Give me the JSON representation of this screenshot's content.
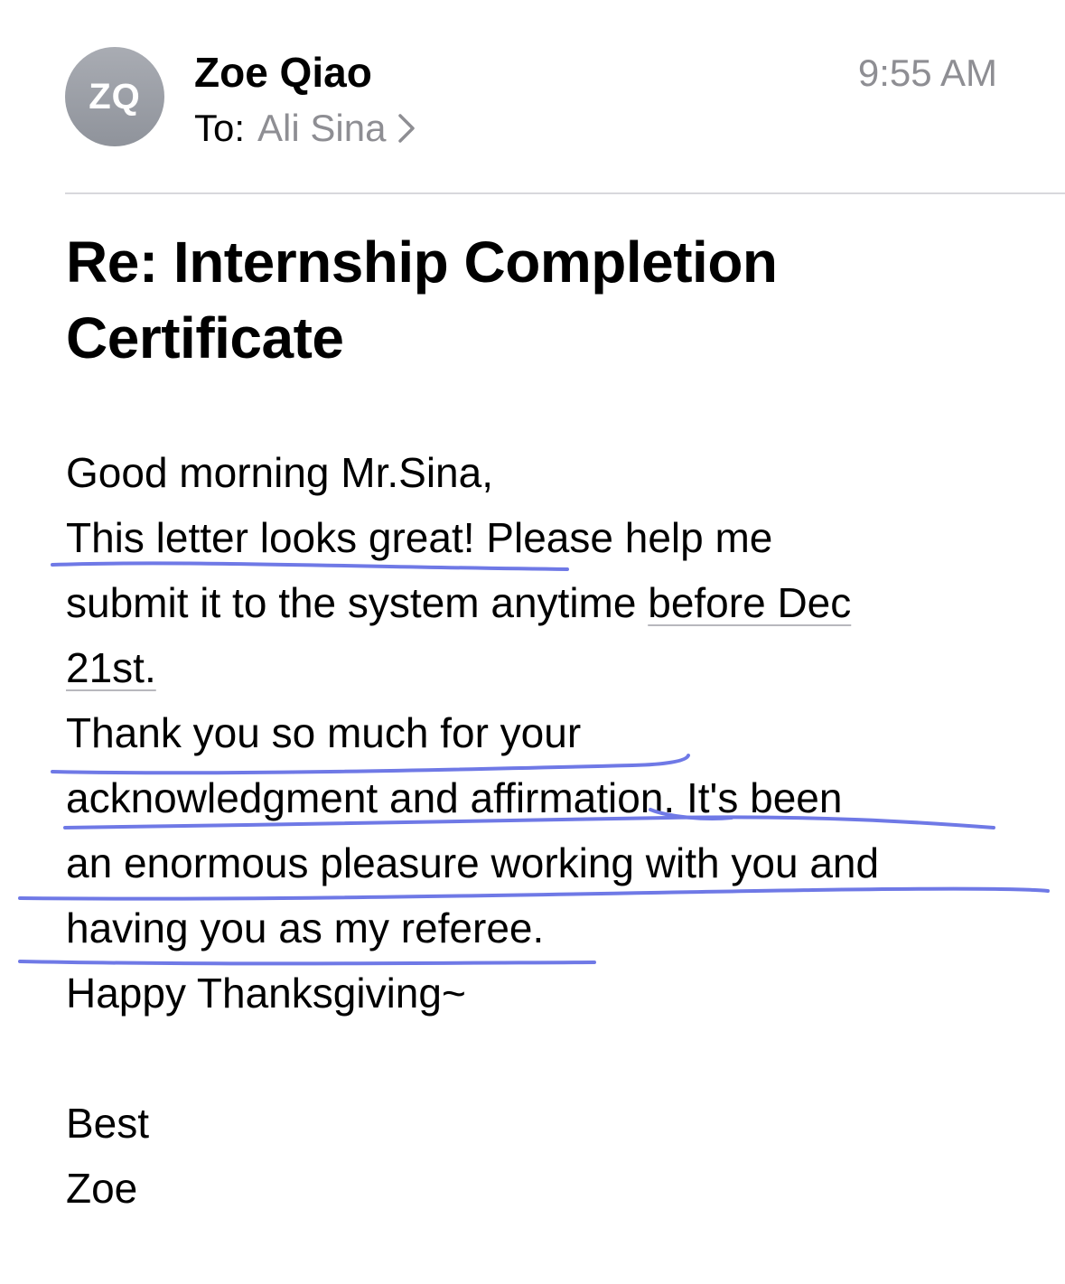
{
  "header": {
    "avatar_initials": "ZQ",
    "sender_name": "Zoe Qiao",
    "to_label": "To:",
    "recipient": "Ali Sina",
    "time": "9:55 AM"
  },
  "subject": "Re: Internship Completion Certificate",
  "body": {
    "greeting": "Good morning Mr.Sina,",
    "line_1": "This letter looks great! Please help me",
    "line_2_prefix": "submit it to the system anytime ",
    "date_link_part1": "before Dec",
    "date_link_part2": "21st.",
    "line_4": "Thank you so much for your",
    "line_5": "acknowledgment and affirmation. It's been",
    "line_6": "an enormous pleasure working with you and",
    "line_7": "having you as my referee.",
    "line_8": "Happy Thanksgiving~",
    "closing": "Best",
    "signature": "Zoe"
  },
  "colors": {
    "secondary_text": "#8e8e93",
    "avatar_bg": "#9a9da4",
    "annotation_ink": "#6f79e6"
  },
  "icons": {
    "recipient_chevron": "chevron-right-icon"
  }
}
